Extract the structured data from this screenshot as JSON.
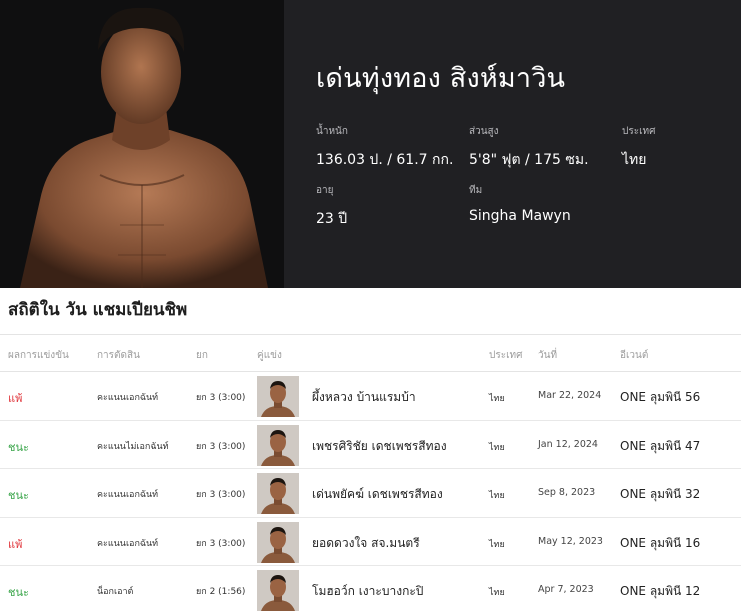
{
  "athlete": {
    "name": "เด่นทุ่งทอง สิงห์มาวิน",
    "stats": {
      "weight_label": "น้ำหนัก",
      "weight_value": "136.03 ป. / 61.7 กก.",
      "height_label": "ส่วนสูง",
      "height_value": "5'8\" ฟุต / 175 ซม.",
      "country_label": "ประเทศ",
      "country_value": "ไทย",
      "age_label": "อายุ",
      "age_value": "23 ปี",
      "team_label": "ทีม",
      "team_value": "Singha Mawyn"
    }
  },
  "section": {
    "title": "สถิติใน วัน แชมเปียนชิพ"
  },
  "table": {
    "headers": {
      "result": "ผลการแข่งขัน",
      "method": "การตัดสิน",
      "round": "ยก",
      "opponent": "คู่แข่ง",
      "country": "ประเทศ",
      "date": "วันที่",
      "event": "อีเวนต์"
    },
    "rows": [
      {
        "result": "แพ้",
        "result_color": "#e0353b",
        "method": "คะแนนเอกฉันท์",
        "round": "ยก 3 (3:00)",
        "opponent": "ผึ้งหลวง บ้านแรมบ้า",
        "country": "ไทย",
        "date": "Mar 22, 2024",
        "event": "ONE ลุมพินี 56"
      },
      {
        "result": "ชนะ",
        "result_color": "#3aa54a",
        "method": "คะแนนไม่เอกฉันท์",
        "round": "ยก 3 (3:00)",
        "opponent": "เพชรศิริชัย เดชเพชรสีทอง",
        "country": "ไทย",
        "date": "Jan 12, 2024",
        "event": "ONE ลุมพินี 47"
      },
      {
        "result": "ชนะ",
        "result_color": "#3aa54a",
        "method": "คะแนนเอกฉันท์",
        "round": "ยก 3 (3:00)",
        "opponent": "เด่นพยัคฆ์ เดชเพชรสีทอง",
        "country": "ไทย",
        "date": "Sep 8, 2023",
        "event": "ONE ลุมพินี 32"
      },
      {
        "result": "แพ้",
        "result_color": "#e0353b",
        "method": "คะแนนเอกฉันท์",
        "round": "ยก 3 (3:00)",
        "opponent": "ยอดดวงใจ สจ.มนตรี",
        "country": "ไทย",
        "date": "May 12, 2023",
        "event": "ONE ลุมพินี 16"
      },
      {
        "result": "ชนะ",
        "result_color": "#3aa54a",
        "method": "น็อกเอาต์",
        "round": "ยก 2 (1:56)",
        "opponent": "โมฮอว์ก เงาะบางกะปิ",
        "country": "ไทย",
        "date": "Apr 7, 2023",
        "event": "ONE ลุมพินี 12"
      }
    ]
  }
}
